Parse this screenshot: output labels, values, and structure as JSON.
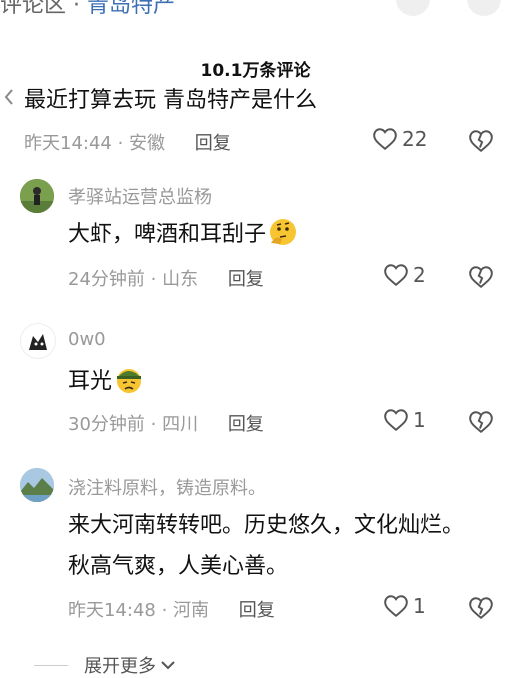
{
  "header": {
    "cut_text_left": "评论区 · ",
    "cut_text_blue": "青岛特产"
  },
  "comment_count": "10.1万条评论",
  "comments": [
    {
      "text": "最近打算去玩 青岛特产是什么",
      "time": "昨天14:44",
      "location": "安徽",
      "reply_label": "回复",
      "likes": "22"
    },
    {
      "author": "孝驿站运营总监杨",
      "text": "大虾，啤酒和耳刮子",
      "emoji": "thinking-face",
      "time": "24分钟前",
      "location": "山东",
      "reply_label": "回复",
      "likes": "2"
    },
    {
      "author": "0w0",
      "text": "耳光",
      "emoji": "helmet-face",
      "time": "30分钟前",
      "location": "四川",
      "reply_label": "回复",
      "likes": "1"
    },
    {
      "author": "浇注料原料，铸造原料。",
      "text_line1": "来大河南转转吧。历史悠久，文化灿烂。",
      "text_line2": "秋高气爽，人美心善。",
      "time": "昨天14:48",
      "location": "河南",
      "reply_label": "回复",
      "likes": "1"
    }
  ],
  "expand_more": "展开更多",
  "colors": {
    "meta": "#999999",
    "text": "#111111",
    "link": "#3d6fb5"
  }
}
